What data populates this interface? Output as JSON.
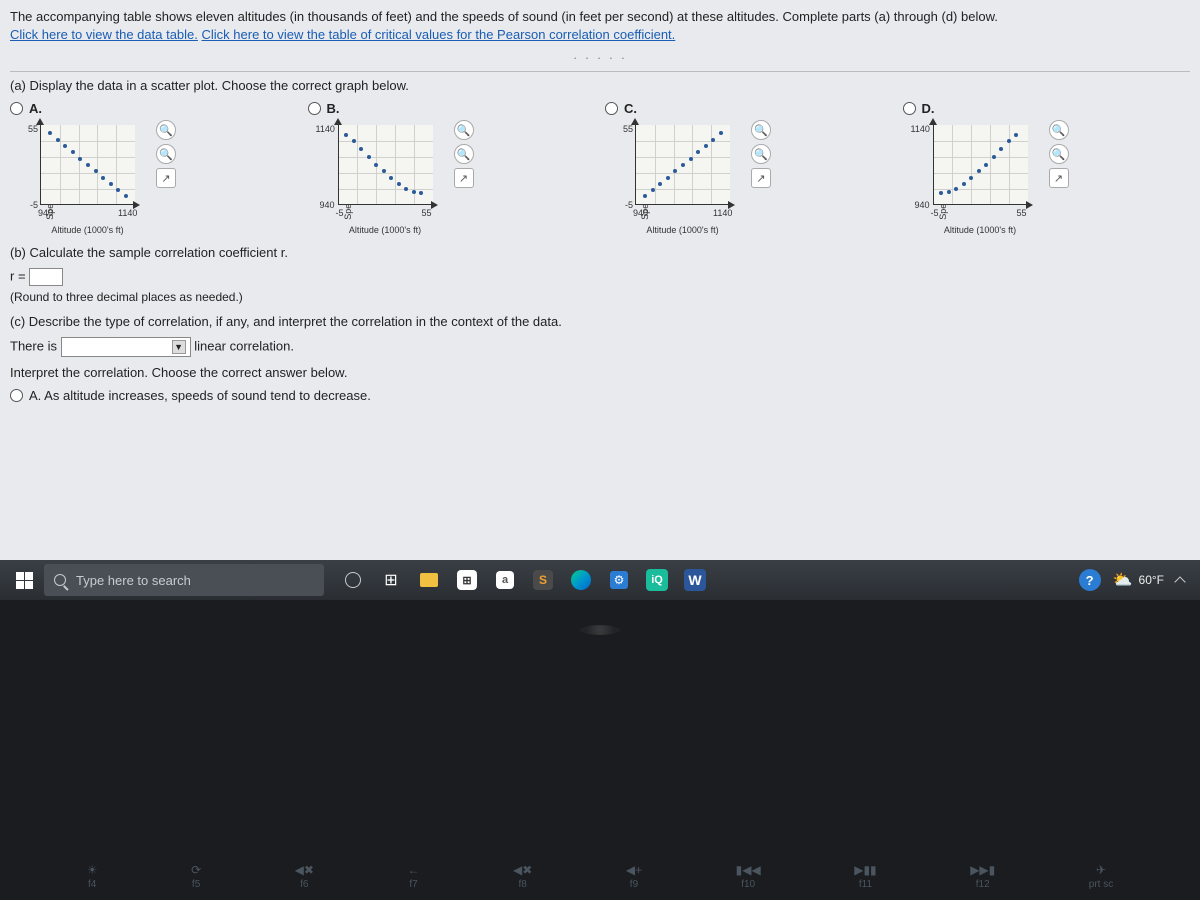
{
  "intro": {
    "text1": "The accompanying table shows eleven altitudes (in thousands of feet) and the speeds of sound (in feet per second) at these altitudes. Complete parts (a) through (d) below.",
    "link1": "Click here to view the data table.",
    "link2": "Click here to view the table of critical values for the Pearson correlation coefficient."
  },
  "part_a": {
    "label": "(a) Display the data in a scatter plot. Choose the correct graph below.",
    "options": {
      "A": "A.",
      "B": "B.",
      "C": "C.",
      "D": "D."
    }
  },
  "charts": {
    "A": {
      "ylabel": "Speed of sound (ft/s)",
      "xlabel": "Altitude (1000's ft)",
      "y_top": "55",
      "y_bot": "-5",
      "x_left": "940",
      "x_right": "1140"
    },
    "B": {
      "ylabel": "Speed of sound (ft/s)",
      "xlabel": "Altitude (1000's ft)",
      "y_top": "1140",
      "y_bot": "940",
      "x_left": "-5",
      "x_right": "55"
    },
    "C": {
      "ylabel": "Speed of sound (ft/s)",
      "xlabel": "Altitude (1000's ft)",
      "y_top": "55",
      "y_bot": "-5",
      "x_left": "940",
      "x_right": "1140"
    },
    "D": {
      "ylabel": "Speed of sound (ft/s)",
      "xlabel": "Altitude (1000's ft)",
      "y_top": "1140",
      "y_bot": "940",
      "x_left": "-5",
      "x_right": "55"
    }
  },
  "part_b": {
    "label": "(b) Calculate the sample correlation coefficient r.",
    "r_eq": "r =",
    "round": "(Round to three decimal places as needed.)"
  },
  "part_c": {
    "label": "(c) Describe the type of correlation, if any, and interpret the correlation in the context of the data.",
    "there_is": "There is",
    "linear_corr": "linear correlation.",
    "interpret": "Interpret the correlation. Choose the correct answer below.",
    "optA": "A.  As altitude increases, speeds of sound tend to decrease."
  },
  "chart_data": [
    {
      "type": "scatter",
      "option": "A",
      "xlabel": "Altitude (1000's ft)",
      "ylabel": "Speed of sound (ft/s)",
      "xlim": [
        940,
        1140
      ],
      "ylim": [
        -5,
        55
      ],
      "x": [
        960,
        980,
        1000,
        1020,
        1040,
        1060,
        1080,
        1100,
        1120,
        1130,
        1140
      ],
      "y": [
        50,
        45,
        40,
        35,
        30,
        25,
        20,
        15,
        10,
        5,
        0
      ]
    },
    {
      "type": "scatter",
      "option": "B",
      "xlabel": "Altitude (1000's ft)",
      "ylabel": "Speed of sound (ft/s)",
      "xlim": [
        -5,
        55
      ],
      "ylim": [
        940,
        1140
      ],
      "x": [
        0,
        5,
        10,
        15,
        20,
        25,
        30,
        35,
        40,
        45,
        50
      ],
      "y": [
        1120,
        1100,
        1080,
        1060,
        1040,
        1020,
        1000,
        980,
        970,
        965,
        960
      ]
    },
    {
      "type": "scatter",
      "option": "C",
      "xlabel": "Altitude (1000's ft)",
      "ylabel": "Speed of sound (ft/s)",
      "xlim": [
        940,
        1140
      ],
      "ylim": [
        -5,
        55
      ],
      "x": [
        960,
        980,
        1000,
        1020,
        1040,
        1060,
        1080,
        1100,
        1120,
        1130,
        1140
      ],
      "y": [
        0,
        5,
        10,
        15,
        20,
        25,
        30,
        35,
        40,
        45,
        50
      ]
    },
    {
      "type": "scatter",
      "option": "D",
      "xlabel": "Altitude (1000's ft)",
      "ylabel": "Speed of sound (ft/s)",
      "xlim": [
        -5,
        55
      ],
      "ylim": [
        940,
        1140
      ],
      "x": [
        0,
        5,
        10,
        15,
        20,
        25,
        30,
        35,
        40,
        45,
        50
      ],
      "y": [
        960,
        965,
        970,
        980,
        1000,
        1020,
        1040,
        1060,
        1080,
        1100,
        1120
      ]
    }
  ],
  "taskbar": {
    "search_placeholder": "Type here to search",
    "weather_temp": "60°F"
  },
  "fn_keys": [
    "f4",
    "f5",
    "f6",
    "f7",
    "f8",
    "f9",
    "f10",
    "f11",
    "f12"
  ],
  "fn_syms": [
    "☀",
    "⟳",
    "◀✖",
    "←",
    "◀✖",
    "◀+",
    "▮◀◀",
    "▶▮▮",
    "▶▶▮"
  ],
  "prtsc": "prt sc"
}
